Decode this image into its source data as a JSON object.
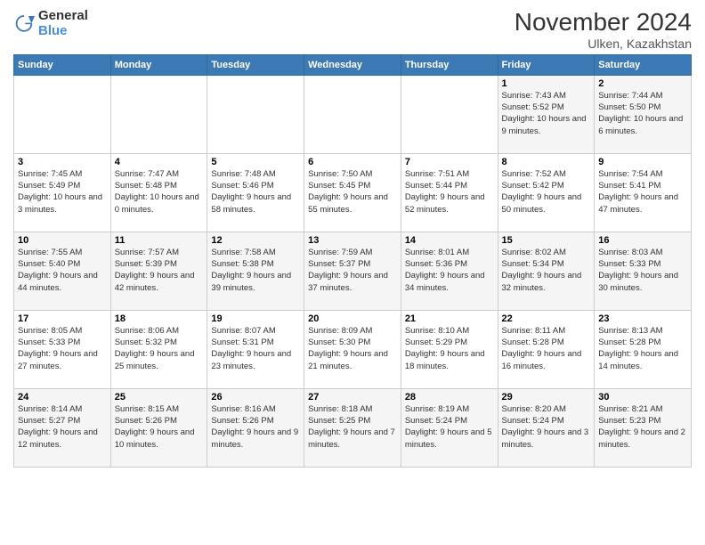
{
  "logo": {
    "general": "General",
    "blue": "Blue"
  },
  "title": "November 2024",
  "subtitle": "Ulken, Kazakhstan",
  "days_of_week": [
    "Sunday",
    "Monday",
    "Tuesday",
    "Wednesday",
    "Thursday",
    "Friday",
    "Saturday"
  ],
  "weeks": [
    [
      {
        "day": "",
        "sunrise": "",
        "sunset": "",
        "daylight": ""
      },
      {
        "day": "",
        "sunrise": "",
        "sunset": "",
        "daylight": ""
      },
      {
        "day": "",
        "sunrise": "",
        "sunset": "",
        "daylight": ""
      },
      {
        "day": "",
        "sunrise": "",
        "sunset": "",
        "daylight": ""
      },
      {
        "day": "",
        "sunrise": "",
        "sunset": "",
        "daylight": ""
      },
      {
        "day": "1",
        "sunrise": "Sunrise: 7:43 AM",
        "sunset": "Sunset: 5:52 PM",
        "daylight": "Daylight: 10 hours and 9 minutes."
      },
      {
        "day": "2",
        "sunrise": "Sunrise: 7:44 AM",
        "sunset": "Sunset: 5:50 PM",
        "daylight": "Daylight: 10 hours and 6 minutes."
      }
    ],
    [
      {
        "day": "3",
        "sunrise": "Sunrise: 7:45 AM",
        "sunset": "Sunset: 5:49 PM",
        "daylight": "Daylight: 10 hours and 3 minutes."
      },
      {
        "day": "4",
        "sunrise": "Sunrise: 7:47 AM",
        "sunset": "Sunset: 5:48 PM",
        "daylight": "Daylight: 10 hours and 0 minutes."
      },
      {
        "day": "5",
        "sunrise": "Sunrise: 7:48 AM",
        "sunset": "Sunset: 5:46 PM",
        "daylight": "Daylight: 9 hours and 58 minutes."
      },
      {
        "day": "6",
        "sunrise": "Sunrise: 7:50 AM",
        "sunset": "Sunset: 5:45 PM",
        "daylight": "Daylight: 9 hours and 55 minutes."
      },
      {
        "day": "7",
        "sunrise": "Sunrise: 7:51 AM",
        "sunset": "Sunset: 5:44 PM",
        "daylight": "Daylight: 9 hours and 52 minutes."
      },
      {
        "day": "8",
        "sunrise": "Sunrise: 7:52 AM",
        "sunset": "Sunset: 5:42 PM",
        "daylight": "Daylight: 9 hours and 50 minutes."
      },
      {
        "day": "9",
        "sunrise": "Sunrise: 7:54 AM",
        "sunset": "Sunset: 5:41 PM",
        "daylight": "Daylight: 9 hours and 47 minutes."
      }
    ],
    [
      {
        "day": "10",
        "sunrise": "Sunrise: 7:55 AM",
        "sunset": "Sunset: 5:40 PM",
        "daylight": "Daylight: 9 hours and 44 minutes."
      },
      {
        "day": "11",
        "sunrise": "Sunrise: 7:57 AM",
        "sunset": "Sunset: 5:39 PM",
        "daylight": "Daylight: 9 hours and 42 minutes."
      },
      {
        "day": "12",
        "sunrise": "Sunrise: 7:58 AM",
        "sunset": "Sunset: 5:38 PM",
        "daylight": "Daylight: 9 hours and 39 minutes."
      },
      {
        "day": "13",
        "sunrise": "Sunrise: 7:59 AM",
        "sunset": "Sunset: 5:37 PM",
        "daylight": "Daylight: 9 hours and 37 minutes."
      },
      {
        "day": "14",
        "sunrise": "Sunrise: 8:01 AM",
        "sunset": "Sunset: 5:36 PM",
        "daylight": "Daylight: 9 hours and 34 minutes."
      },
      {
        "day": "15",
        "sunrise": "Sunrise: 8:02 AM",
        "sunset": "Sunset: 5:34 PM",
        "daylight": "Daylight: 9 hours and 32 minutes."
      },
      {
        "day": "16",
        "sunrise": "Sunrise: 8:03 AM",
        "sunset": "Sunset: 5:33 PM",
        "daylight": "Daylight: 9 hours and 30 minutes."
      }
    ],
    [
      {
        "day": "17",
        "sunrise": "Sunrise: 8:05 AM",
        "sunset": "Sunset: 5:33 PM",
        "daylight": "Daylight: 9 hours and 27 minutes."
      },
      {
        "day": "18",
        "sunrise": "Sunrise: 8:06 AM",
        "sunset": "Sunset: 5:32 PM",
        "daylight": "Daylight: 9 hours and 25 minutes."
      },
      {
        "day": "19",
        "sunrise": "Sunrise: 8:07 AM",
        "sunset": "Sunset: 5:31 PM",
        "daylight": "Daylight: 9 hours and 23 minutes."
      },
      {
        "day": "20",
        "sunrise": "Sunrise: 8:09 AM",
        "sunset": "Sunset: 5:30 PM",
        "daylight": "Daylight: 9 hours and 21 minutes."
      },
      {
        "day": "21",
        "sunrise": "Sunrise: 8:10 AM",
        "sunset": "Sunset: 5:29 PM",
        "daylight": "Daylight: 9 hours and 18 minutes."
      },
      {
        "day": "22",
        "sunrise": "Sunrise: 8:11 AM",
        "sunset": "Sunset: 5:28 PM",
        "daylight": "Daylight: 9 hours and 16 minutes."
      },
      {
        "day": "23",
        "sunrise": "Sunrise: 8:13 AM",
        "sunset": "Sunset: 5:28 PM",
        "daylight": "Daylight: 9 hours and 14 minutes."
      }
    ],
    [
      {
        "day": "24",
        "sunrise": "Sunrise: 8:14 AM",
        "sunset": "Sunset: 5:27 PM",
        "daylight": "Daylight: 9 hours and 12 minutes."
      },
      {
        "day": "25",
        "sunrise": "Sunrise: 8:15 AM",
        "sunset": "Sunset: 5:26 PM",
        "daylight": "Daylight: 9 hours and 10 minutes."
      },
      {
        "day": "26",
        "sunrise": "Sunrise: 8:16 AM",
        "sunset": "Sunset: 5:26 PM",
        "daylight": "Daylight: 9 hours and 9 minutes."
      },
      {
        "day": "27",
        "sunrise": "Sunrise: 8:18 AM",
        "sunset": "Sunset: 5:25 PM",
        "daylight": "Daylight: 9 hours and 7 minutes."
      },
      {
        "day": "28",
        "sunrise": "Sunrise: 8:19 AM",
        "sunset": "Sunset: 5:24 PM",
        "daylight": "Daylight: 9 hours and 5 minutes."
      },
      {
        "day": "29",
        "sunrise": "Sunrise: 8:20 AM",
        "sunset": "Sunset: 5:24 PM",
        "daylight": "Daylight: 9 hours and 3 minutes."
      },
      {
        "day": "30",
        "sunrise": "Sunrise: 8:21 AM",
        "sunset": "Sunset: 5:23 PM",
        "daylight": "Daylight: 9 hours and 2 minutes."
      }
    ]
  ]
}
